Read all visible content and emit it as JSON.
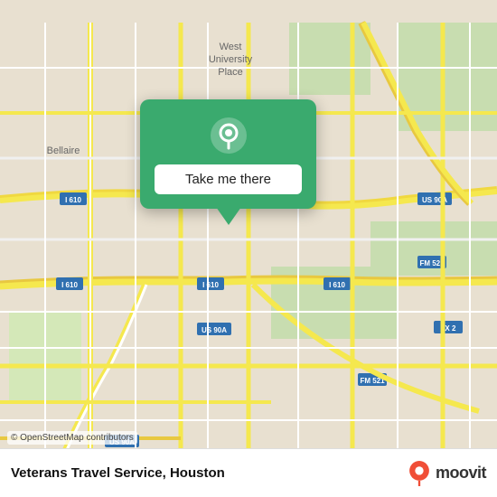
{
  "map": {
    "background_color": "#e8e0d0",
    "road_color_major": "#f5e84e",
    "road_color_minor": "#ffffff",
    "road_color_highway": "#e8c84e",
    "green_area_color": "#c8ddb0"
  },
  "popup": {
    "background_color": "#3aaa6e",
    "button_label": "Take me there",
    "pin_icon": "location-pin-icon"
  },
  "bottom_bar": {
    "location_name": "Veterans Travel Service, Houston",
    "osm_credit": "© OpenStreetMap contributors",
    "moovit_logo_text": "moovit"
  }
}
